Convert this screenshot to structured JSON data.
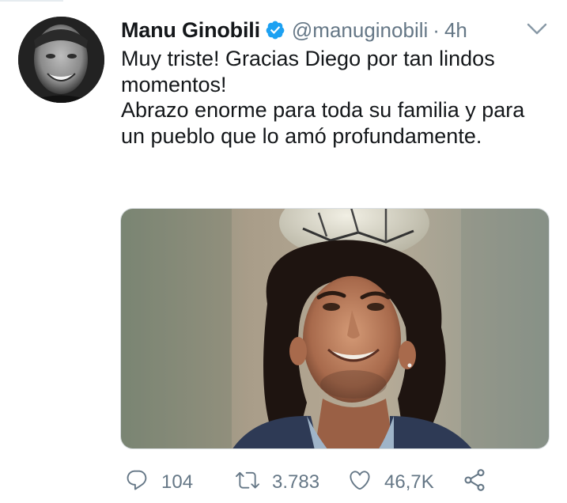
{
  "tweet": {
    "author": {
      "display_name": "Manu Ginobili",
      "handle": "@manuginobili",
      "verified": true,
      "avatar_icon": "profile-photo",
      "verified_icon": "verified-badge-icon"
    },
    "separator": "·",
    "timestamp": "4h",
    "menu_icon": "chevron-down-icon",
    "text_lines": [
      "Muy triste! Gracias Diego por tan lindos momentos!",
      "Abrazo enorme para toda su familia y para un pueblo que lo amó profundamente."
    ],
    "media": {
      "type": "photo"
    },
    "actions": {
      "reply": {
        "icon": "reply-icon",
        "count": "104"
      },
      "retweet": {
        "icon": "retweet-icon",
        "count": "3.783"
      },
      "like": {
        "icon": "heart-icon",
        "count": "46,7K"
      },
      "share": {
        "icon": "share-icon"
      }
    }
  },
  "colors": {
    "text": "#14171a",
    "secondary": "#657786",
    "verified": "#1da1f2",
    "background": "#ffffff"
  }
}
